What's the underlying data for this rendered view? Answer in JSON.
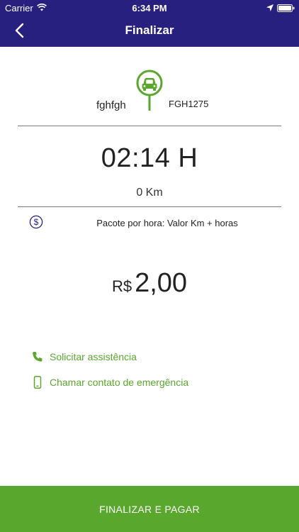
{
  "status_bar": {
    "carrier": "Carrier",
    "time": "6:34 PM"
  },
  "header": {
    "title": "Finalizar"
  },
  "vehicle": {
    "name": "fghfgh",
    "plate": "FGH1275",
    "icon": "car-icon"
  },
  "trip": {
    "duration": "02:14 H",
    "distance": "0 Km"
  },
  "package": {
    "label": "Pacote por hora: Valor Km + horas",
    "icon": "dollar-icon"
  },
  "price": {
    "currency": "R$",
    "amount": "2,00"
  },
  "links": {
    "assistance": {
      "label": "Solicitar assistência",
      "icon": "phone-icon"
    },
    "emergency": {
      "label": "Chamar contato de emergência",
      "icon": "mobile-phone-icon"
    }
  },
  "actions": {
    "finish_pay": "FINALIZAR E PAGAR"
  },
  "colors": {
    "header": "#28207f",
    "accent": "#5aa72e"
  }
}
